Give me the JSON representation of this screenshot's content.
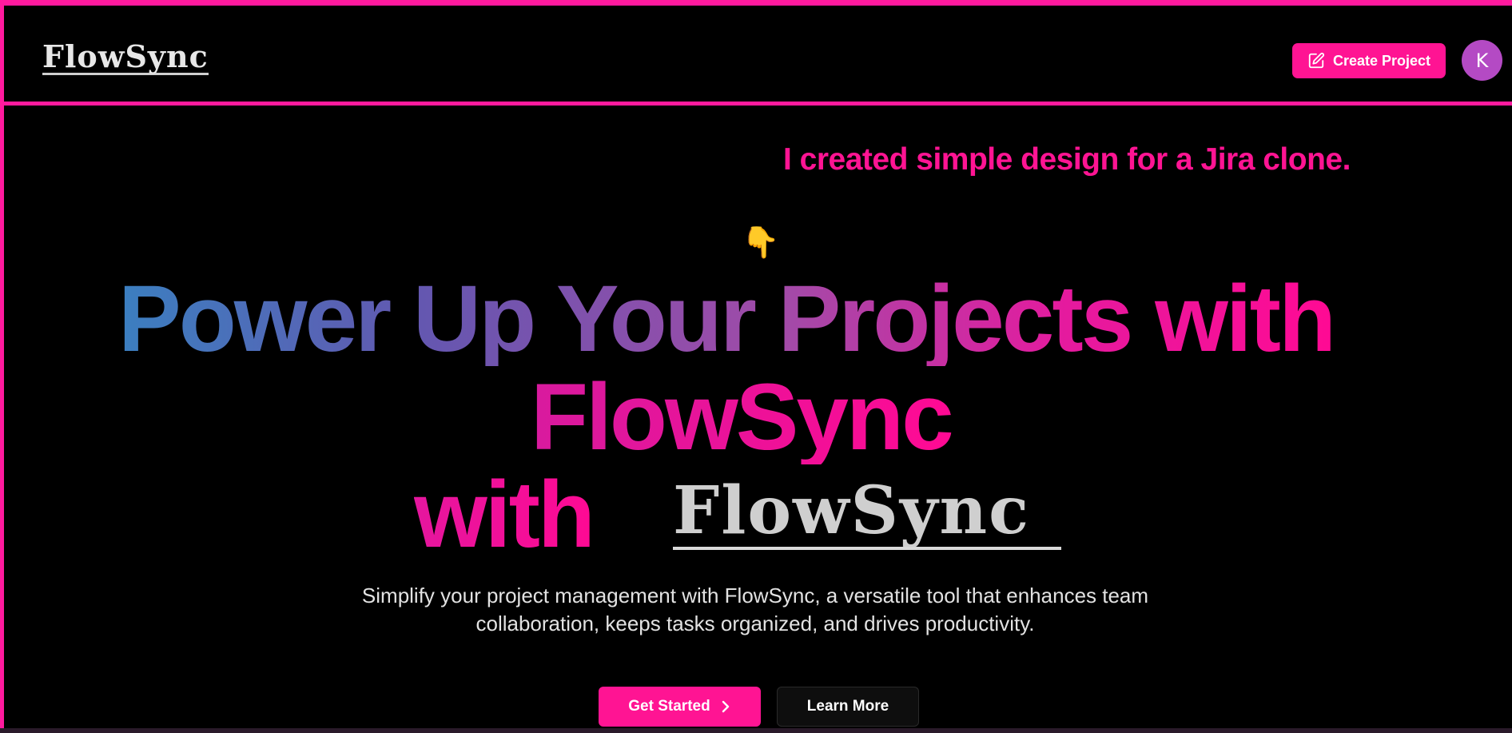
{
  "header": {
    "logo_text": "FlowSync",
    "create_project_label": "Create Project",
    "avatar_initial": "K"
  },
  "hero": {
    "tagline": "I created simple design for a Jira clone.",
    "pointer_emoji": "👇",
    "title_line1": "Power Up Your Projects with",
    "title_line2": "FlowSync",
    "title_line3": "with",
    "title_logo": "FlowSync",
    "subtitle": "Simplify your project management with FlowSync, a versatile tool that enhances team collaboration, keeps tasks organized, and drives productivity."
  },
  "actions": {
    "get_started_label": "Get Started",
    "learn_more_label": "Learn More"
  },
  "colors": {
    "accent": "#ff1493",
    "background": "#000000",
    "avatar": "#b44ac4",
    "gradient_start": "#3b7fc0",
    "gradient_end": "#ff0a94"
  },
  "icons": {
    "create_project": "edit-icon",
    "get_started": "chevron-right-icon",
    "pointer": "pointing-down-hand-icon"
  }
}
